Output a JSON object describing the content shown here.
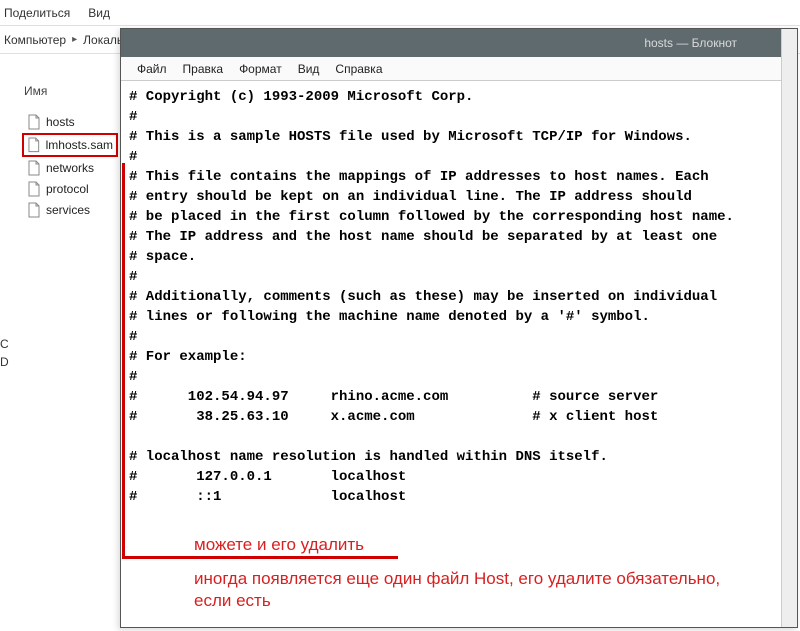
{
  "explorer": {
    "top_menu": [
      "Поделиться",
      "Вид"
    ],
    "breadcrumb": [
      "Компьютер",
      "Локаль"
    ],
    "column_header": "Имя",
    "files": [
      {
        "name": "hosts",
        "highlight": false
      },
      {
        "name": "lmhosts.sam",
        "highlight": true
      },
      {
        "name": "networks",
        "highlight": false
      },
      {
        "name": "protocol",
        "highlight": false
      },
      {
        "name": "services",
        "highlight": false
      }
    ],
    "side_cut": [
      "C",
      "D"
    ]
  },
  "notepad": {
    "title": "hosts — Блокнот",
    "menu": [
      "Файл",
      "Правка",
      "Формат",
      "Вид",
      "Справка"
    ],
    "lines": [
      "# Copyright (c) 1993-2009 Microsoft Corp.",
      "#",
      "# This is a sample HOSTS file used by Microsoft TCP/IP for Windows.",
      "#",
      "# This file contains the mappings of IP addresses to host names. Each",
      "# entry should be kept on an individual line. The IP address should",
      "# be placed in the first column followed by the corresponding host name.",
      "# The IP address and the host name should be separated by at least one",
      "# space.",
      "#",
      "# Additionally, comments (such as these) may be inserted on individual",
      "# lines or following the machine name denoted by a '#' symbol.",
      "#",
      "# For example:",
      "#",
      "#      102.54.94.97     rhino.acme.com          # source server",
      "#       38.25.63.10     x.acme.com              # x client host",
      "",
      "# localhost name resolution is handled within DNS itself.",
      "#       127.0.0.1       localhost",
      "#       ::1             localhost"
    ]
  },
  "annotations": {
    "line1": "можете и его удалить",
    "line2": "иногда появляется еще один файл Host, его удалите обязательно, если есть"
  }
}
